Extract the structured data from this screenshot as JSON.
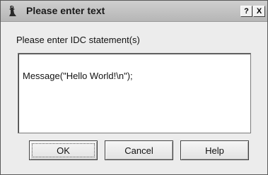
{
  "window": {
    "title": "Please enter text",
    "help_glyph": "?",
    "close_glyph": "X"
  },
  "prompt": {
    "label": "Please enter IDC statement(s)"
  },
  "editor": {
    "value": "Message(\"Hello World!\\n\");"
  },
  "buttons": {
    "ok": "OK",
    "cancel": "Cancel",
    "help": "Help"
  },
  "icons": {
    "app": "ida-icon",
    "help": "help-icon",
    "close": "close-icon"
  }
}
